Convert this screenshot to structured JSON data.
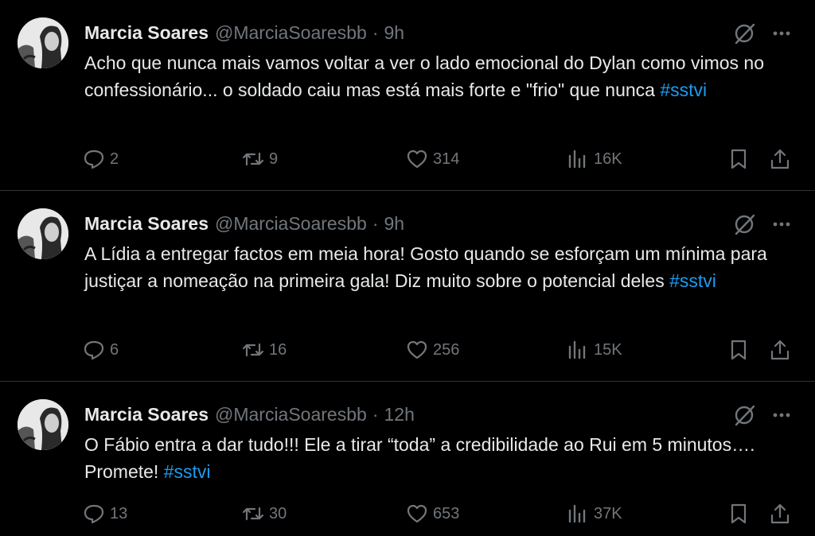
{
  "tweets": [
    {
      "name": "Marcia Soares",
      "handle": "@MarciaSoaresbb",
      "separator": "·",
      "time": "9h",
      "text": "Acho que nunca mais vamos voltar a ver o lado emocional do Dylan como vimos no confessionário... o soldado caiu mas está mais forte e \"frio\" que nunca ",
      "hashtag": "#sstvi",
      "replies": "2",
      "retweets": "9",
      "likes": "314",
      "views": "16K"
    },
    {
      "name": "Marcia Soares",
      "handle": "@MarciaSoaresbb",
      "separator": "·",
      "time": "9h",
      "text": "A Lídia a entregar factos em meia hora! Gosto quando se esforçam um mínima para justiçar a nomeação na primeira gala! Diz muito sobre o potencial deles ",
      "hashtag": "#sstvi",
      "replies": "6",
      "retweets": "16",
      "likes": "256",
      "views": "15K"
    },
    {
      "name": "Marcia Soares",
      "handle": "@MarciaSoaresbb",
      "separator": "·",
      "time": "12h",
      "text": "O Fábio entra a dar tudo!!! Ele a tirar “toda” a credibilidade ao Rui em 5 minutos…. Promete! ",
      "hashtag": "#sstvi",
      "replies": "13",
      "retweets": "30",
      "likes": "653",
      "views": "37K"
    }
  ],
  "icons": {
    "reply": "reply-icon",
    "retweet": "retweet-icon",
    "like": "heart-icon",
    "views": "views-icon",
    "bookmark": "bookmark-icon",
    "share": "share-icon",
    "grok": "grok-icon",
    "more": "more-icon"
  },
  "colors": {
    "background": "#000000",
    "text": "#e7e9ea",
    "muted": "#71767b",
    "hashtag": "#1d9bf0",
    "divider": "#2f3336"
  }
}
